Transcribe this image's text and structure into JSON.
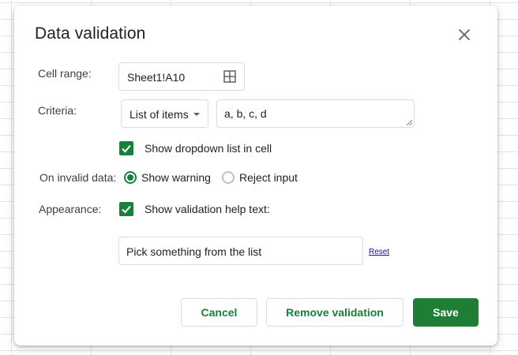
{
  "dialog": {
    "title": "Data validation",
    "close_icon": "close-icon"
  },
  "cell_range": {
    "label": "Cell range:",
    "value": "Sheet1!A10",
    "icon": "grid-select-icon"
  },
  "criteria": {
    "label": "Criteria:",
    "type_selected": "List of items",
    "items_value": "a, b, c, d",
    "show_dropdown_label": "Show dropdown list in cell",
    "show_dropdown_checked": true
  },
  "invalid_data": {
    "label": "On invalid data:",
    "options": [
      {
        "label": "Show warning",
        "selected": true
      },
      {
        "label": "Reject input",
        "selected": false
      }
    ]
  },
  "appearance": {
    "label": "Appearance:",
    "help_text_label": "Show validation help text:",
    "help_text_checked": true,
    "help_text_value": "Pick something from the list",
    "reset_label": "Reset"
  },
  "buttons": {
    "cancel": "Cancel",
    "remove": "Remove validation",
    "save": "Save"
  },
  "colors": {
    "accent": "#188038",
    "primary_button": "#1e7e34"
  }
}
